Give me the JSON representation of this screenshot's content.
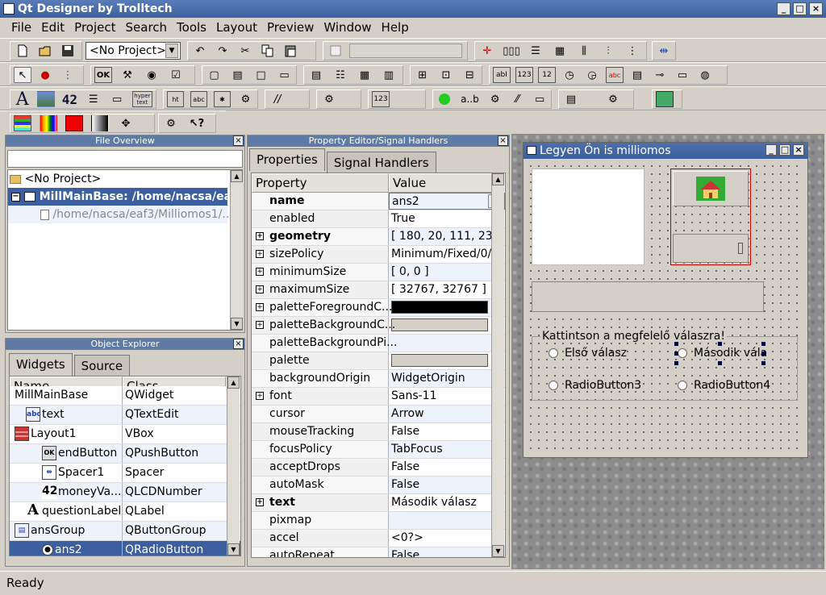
{
  "app": {
    "title": "Qt Designer by Trolltech"
  },
  "menu": [
    "File",
    "Edit",
    "Project",
    "Search",
    "Tools",
    "Layout",
    "Preview",
    "Window",
    "Help"
  ],
  "toolbar": {
    "project_combo": "<No Project>",
    "label_42": "42",
    "hypertext": "hyper text",
    "ab_label": "a..b"
  },
  "file_overview": {
    "title": "File Overview",
    "items": [
      "<No Project>",
      "MillMainBase: /home/nacsa/eaf3/",
      "/home/nacsa/eaf3/Milliomos1/..."
    ]
  },
  "object_explorer": {
    "title": "Object Explorer",
    "tabs": [
      "Widgets",
      "Source"
    ],
    "headers": [
      "Name",
      "Class"
    ],
    "rows": [
      {
        "name": "MillMainBase",
        "cls": "QWidget"
      },
      {
        "name": "text",
        "cls": "QTextEdit"
      },
      {
        "name": "Layout1",
        "cls": "VBox"
      },
      {
        "name": "endButton",
        "cls": "QPushButton"
      },
      {
        "name": "Spacer1",
        "cls": "Spacer"
      },
      {
        "name": "moneyVa...",
        "cls": "QLCDNumber"
      },
      {
        "name": "questionLabel",
        "cls": "QLabel"
      },
      {
        "name": "ansGroup",
        "cls": "QButtonGroup"
      },
      {
        "name": "ans2",
        "cls": "QRadioButton"
      }
    ]
  },
  "property_editor": {
    "title": "Property Editor/Signal Handlers",
    "tabs": [
      "Properties",
      "Signal Handlers"
    ],
    "headers": [
      "Property",
      "Value"
    ],
    "rows": [
      {
        "name": "name",
        "value": "ans2",
        "bold": true,
        "plus": false
      },
      {
        "name": "enabled",
        "value": "True",
        "bold": false,
        "plus": false
      },
      {
        "name": "geometry",
        "value": "[ 180, 20, 111, 23 ]",
        "bold": true,
        "plus": true
      },
      {
        "name": "sizePolicy",
        "value": "Minimum/Fixed/0/0",
        "bold": false,
        "plus": true
      },
      {
        "name": "minimumSize",
        "value": "[ 0, 0 ]",
        "bold": false,
        "plus": true
      },
      {
        "name": "maximumSize",
        "value": "[ 32767, 32767 ]",
        "bold": false,
        "plus": true
      },
      {
        "name": "paletteForegroundC...",
        "value": "",
        "bold": false,
        "plus": true
      },
      {
        "name": "paletteBackgroundC...",
        "value": "",
        "bold": false,
        "plus": true
      },
      {
        "name": "paletteBackgroundPi...",
        "value": "",
        "bold": false,
        "plus": false
      },
      {
        "name": "palette",
        "value": "",
        "bold": false,
        "plus": false
      },
      {
        "name": "backgroundOrigin",
        "value": "WidgetOrigin",
        "bold": false,
        "plus": false
      },
      {
        "name": "font",
        "value": "Sans-11",
        "bold": false,
        "plus": true
      },
      {
        "name": "cursor",
        "value": "Arrow",
        "bold": false,
        "plus": false
      },
      {
        "name": "mouseTracking",
        "value": "False",
        "bold": false,
        "plus": false
      },
      {
        "name": "focusPolicy",
        "value": "TabFocus",
        "bold": false,
        "plus": false
      },
      {
        "name": "acceptDrops",
        "value": "False",
        "bold": false,
        "plus": false
      },
      {
        "name": "autoMask",
        "value": "False",
        "bold": false,
        "plus": false
      },
      {
        "name": "text",
        "value": "Második válasz",
        "bold": true,
        "plus": true
      },
      {
        "name": "pixmap",
        "value": "",
        "bold": false,
        "plus": false
      },
      {
        "name": "accel",
        "value": "<0?>",
        "bold": false,
        "plus": false
      },
      {
        "name": "autoRepeat",
        "value": "False",
        "bold": false,
        "plus": false
      }
    ],
    "colors": {
      "fg": "#000000",
      "bg": "#d4d0c8"
    }
  },
  "form": {
    "title": "Legyen Ön is milliomos",
    "group_title": "Kattintson a megfelelő válaszra!",
    "radios": [
      "Első válasz",
      "Második vála",
      "RadioButton3",
      "RadioButton4"
    ]
  },
  "status": {
    "text": "Ready"
  }
}
